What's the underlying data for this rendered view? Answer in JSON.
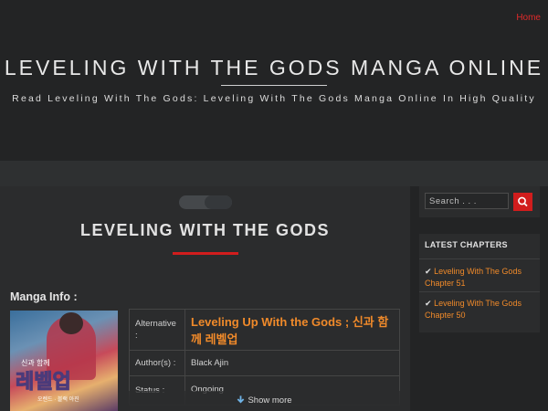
{
  "nav": {
    "home_label": "Home"
  },
  "site": {
    "title": "LEVELING WITH THE GODS MANGA ONLINE",
    "tagline": "Read Leveling With The Gods: Leveling With The Gods Manga Online In High Quality"
  },
  "page": {
    "title": "LEVELING WITH THE GODS",
    "section_title": "Manga Info :",
    "cover_title": "레벨업",
    "cover_subtitle": "신과 함께",
    "cover_credit": "오렌드 · 블랙 아진",
    "info_rows": [
      {
        "label": "Alternative :",
        "value": "Leveling Up With the Gods ; 신과 함께 레벨업"
      },
      {
        "label": "Author(s) :",
        "value": "Black Ajin"
      },
      {
        "label": "Status :",
        "value": "Ongoing"
      }
    ],
    "show_more_label": "Show more"
  },
  "sidebar": {
    "search_placeholder": "Search . . .",
    "latest_title": "LATEST CHAPTERS",
    "chapters": [
      {
        "check": "✔",
        "label": "Leveling With The Gods Chapter 51"
      },
      {
        "check": "✔",
        "label": "Leveling With The Gods Chapter 50"
      }
    ]
  },
  "colors": {
    "accent_red": "#d11d1d",
    "link_orange": "#f08a2a",
    "background": "#232425"
  }
}
